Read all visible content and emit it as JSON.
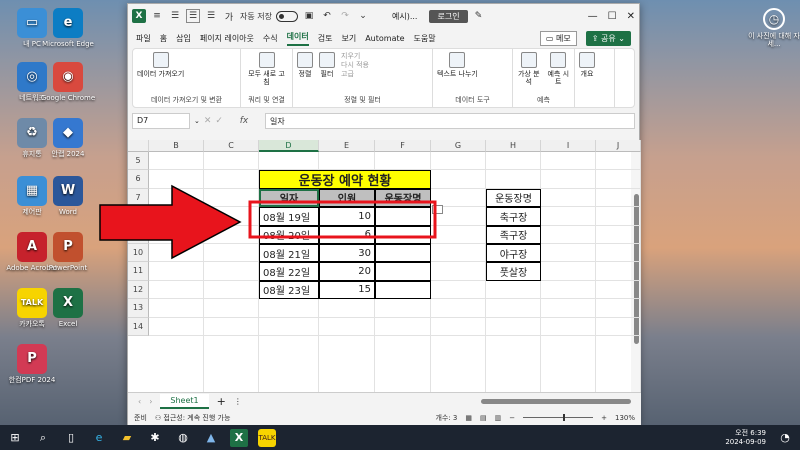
{
  "desktop_icons": [
    {
      "label": "내 PC",
      "color": "#3b8fd6",
      "glyph": "▭"
    },
    {
      "label": "Microsoft Edge",
      "color": "#0c7dc4",
      "glyph": "e"
    },
    {
      "label": "네트워크",
      "color": "#2f79c9",
      "glyph": "◎"
    },
    {
      "label": "Google Chrome",
      "color": "#d9493e",
      "glyph": "◉"
    },
    {
      "label": "휴지통",
      "color": "#6e8aa8",
      "glyph": "♻"
    },
    {
      "label": "안랩 2024",
      "color": "#3578d0",
      "glyph": "◆"
    },
    {
      "label": "제어판",
      "color": "#3b8fd6",
      "glyph": "▦"
    },
    {
      "label": "Word",
      "color": "#2b579a",
      "glyph": "W"
    },
    {
      "label": "Adobe Acrobat",
      "color": "#c6222c",
      "glyph": "A"
    },
    {
      "label": "PowerPoint",
      "color": "#c1502e",
      "glyph": "P"
    },
    {
      "label": "카카오톡",
      "color": "#f7d400",
      "glyph": "TALK"
    },
    {
      "label": "Excel",
      "color": "#1e7145",
      "glyph": "X"
    },
    {
      "label": "한컴PDF 2024",
      "color": "#d23a54",
      "glyph": "P"
    }
  ],
  "right_icon": {
    "label": "이 사진에 대해 자세...",
    "glyph": "◷"
  },
  "window": {
    "autosave_label": "자동 저장",
    "autosave_state": "끔",
    "doc_title": "예시)...",
    "login": "로그인",
    "tabs": [
      "파일",
      "홈",
      "삽입",
      "페이지 레이아웃",
      "수식",
      "데이터",
      "검토",
      "보기",
      "Automate",
      "도움말"
    ],
    "active_tab": "데이터",
    "memo": "메모",
    "share": "공유"
  },
  "ribbon": [
    {
      "label": "데이터 가져오기 및 변환",
      "buttons": [
        "데이터 가져오기"
      ]
    },
    {
      "label": "쿼리 및 연결",
      "buttons": [
        "모두 새로 고침"
      ]
    },
    {
      "label": "정렬 및 필터",
      "buttons": [
        "정렬",
        "필터"
      ],
      "small": [
        "지우기",
        "다시 적용",
        "고급"
      ]
    },
    {
      "label": "데이터 도구",
      "buttons": [
        "텍스트 나누기"
      ]
    },
    {
      "label": "예측",
      "buttons": [
        "가상 분석",
        "예측 시트"
      ]
    },
    {
      "label": "",
      "buttons": [
        "개요"
      ]
    }
  ],
  "formula": {
    "name_box": "D7",
    "fx": "fx",
    "value": "일자"
  },
  "columns": [
    "B",
    "C",
    "D",
    "E",
    "F",
    "G",
    "H",
    "I",
    "J"
  ],
  "rows": [
    "5",
    "6",
    "7",
    "8",
    "9",
    "10",
    "11",
    "12",
    "13",
    "14"
  ],
  "table": {
    "title": "운동장 예약 현황",
    "headers": [
      "일자",
      "인원",
      "운동장명"
    ],
    "rows": [
      [
        "08월 19일",
        "10",
        ""
      ],
      [
        "08월 20일",
        "6",
        ""
      ],
      [
        "08월 21일",
        "30",
        ""
      ],
      [
        "08월 22일",
        "20",
        ""
      ],
      [
        "08월 23일",
        "15",
        ""
      ]
    ]
  },
  "side_list": {
    "header": "운동장명",
    "items": [
      "축구장",
      "족구장",
      "야구장",
      "풋살장"
    ]
  },
  "sheet": {
    "tab": "Sheet1",
    "add": "+"
  },
  "status": {
    "ready": "준비",
    "accessibility": "접근성: 계속 진행 가능",
    "count": "개수: 3",
    "zoom": "130%"
  },
  "taskbar": {
    "time": "오전 6:39",
    "date": "2024-09-09"
  },
  "colors": {
    "excel_green": "#1e7145",
    "title_fill": "#ffff00",
    "header_fill": "#bfbfbf",
    "arrow": "#e8141c",
    "highlight_border": "#e8141c"
  }
}
